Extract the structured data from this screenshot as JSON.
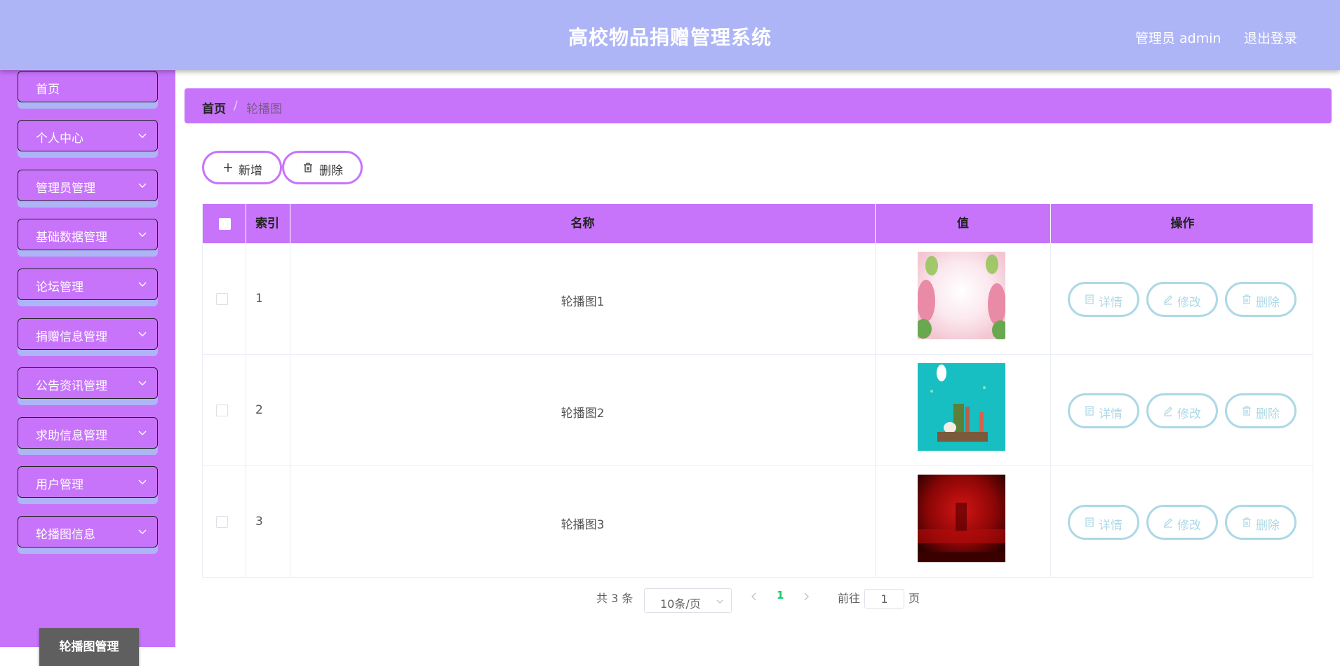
{
  "header": {
    "title": "高校物品捐赠管理系统",
    "user": "管理员 admin",
    "logout": "退出登录"
  },
  "sidebar": {
    "items": [
      {
        "label": "首页",
        "chevron": false
      },
      {
        "label": "个人中心",
        "chevron": true
      },
      {
        "label": "管理员管理",
        "chevron": true
      },
      {
        "label": "基础数据管理",
        "chevron": true
      },
      {
        "label": "论坛管理",
        "chevron": true
      },
      {
        "label": "捐赠信息管理",
        "chevron": true
      },
      {
        "label": "公告资讯管理",
        "chevron": true
      },
      {
        "label": "求助信息管理",
        "chevron": true
      },
      {
        "label": "用户管理",
        "chevron": true
      },
      {
        "label": "轮播图信息",
        "chevron": true
      }
    ],
    "active_sub": "轮播图管理"
  },
  "breadcrumb": {
    "home": "首页",
    "separator": "/",
    "current": "轮播图"
  },
  "toolbar": {
    "add_label": "新增",
    "delete_label": "删除"
  },
  "table": {
    "headers": {
      "index": "索引",
      "name": "名称",
      "value": "值",
      "actions": "操作"
    },
    "rows": [
      {
        "index": "1",
        "name": "轮播图1",
        "image": "pink-flowers"
      },
      {
        "index": "2",
        "name": "轮播图2",
        "image": "teal-city"
      },
      {
        "index": "3",
        "name": "轮播图3",
        "image": "red-stage"
      }
    ],
    "actions": {
      "detail": "详情",
      "edit": "修改",
      "delete": "删除"
    }
  },
  "pagination": {
    "total_text": "共 3 条",
    "page_size": "10条/页",
    "current_page": "1",
    "goto_label": "前往",
    "goto_value": "1",
    "page_suffix": "页",
    "active_color": "#13ce66"
  },
  "colors": {
    "header": "#adb5f6",
    "sidebar": "#c774fb",
    "accent": "#c774fb",
    "action_border": "#add8e6"
  }
}
